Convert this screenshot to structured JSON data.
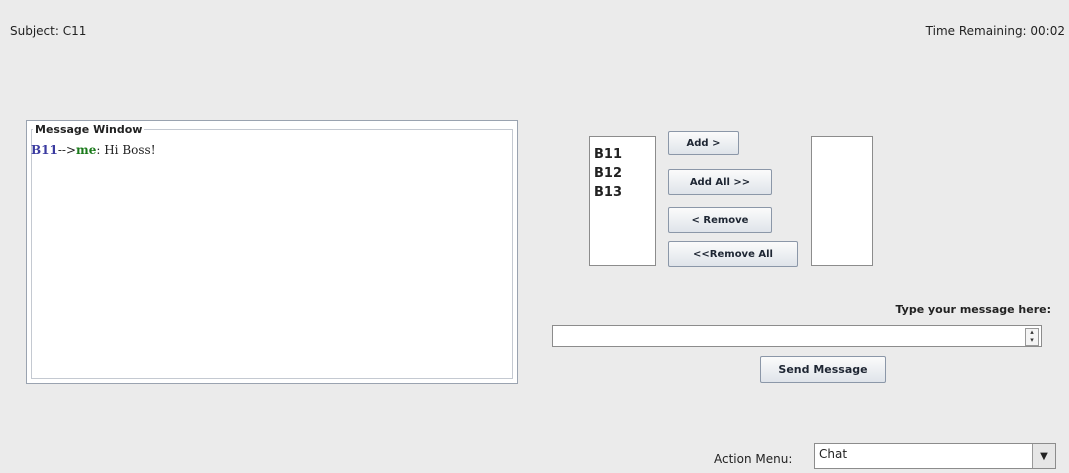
{
  "header": {
    "subject": "Subject: C11",
    "time_remaining": "Time Remaining: 00:02"
  },
  "message_window": {
    "title": "Message Window",
    "messages": [
      {
        "from_label": "B11-->me",
        "from": "B11",
        "arrow": "-->",
        "to": "me",
        "separator": ":",
        "text": " Hi Boss!"
      }
    ]
  },
  "available_list": {
    "items": [
      "B11",
      "B12",
      "B13"
    ]
  },
  "selected_list": {
    "items": []
  },
  "buttons": {
    "add": "Add >",
    "add_all": "Add All >>",
    "remove": "< Remove",
    "remove_all": "<<Remove All",
    "send": "Send Message"
  },
  "message_input": {
    "prompt": "Type your message here:",
    "value": ""
  },
  "action_menu": {
    "label": "Action Menu:",
    "selected": "Chat"
  },
  "colors": {
    "background": "#ebebeb",
    "sender": "#3a3aa0",
    "recipient": "#1a7a1a"
  }
}
